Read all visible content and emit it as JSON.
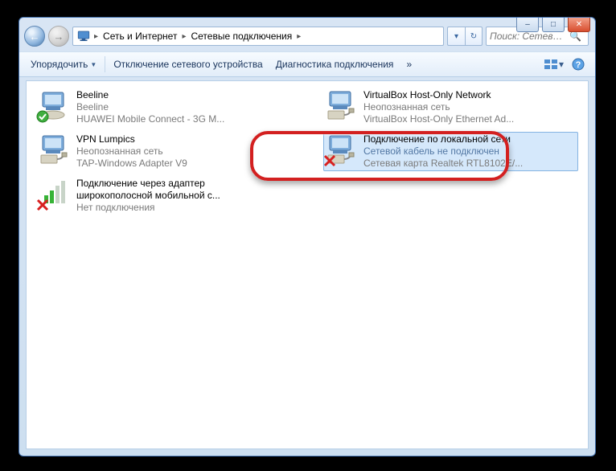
{
  "win_controls": {
    "min": "–",
    "max": "□",
    "close": "✕"
  },
  "breadcrumbs": {
    "a": "Сеть и Интернет",
    "b": "Сетевые подключения"
  },
  "search": {
    "placeholder": "Поиск: Сетев…",
    "icon": "🔍"
  },
  "refresh": {
    "down": "▾",
    "ref": "↻"
  },
  "toolbar": {
    "organize": "Упорядочить",
    "disable": "Отключение сетевого устройства",
    "diag": "Диагностика подключения",
    "more": "»",
    "view_drop": "▾",
    "help": "?"
  },
  "items": {
    "beeline": {
      "l1": "Beeline",
      "l2": "Beeline",
      "l3": "HUAWEI Mobile Connect - 3G M..."
    },
    "vbox": {
      "l1": "VirtualBox Host-Only Network",
      "l2": "Неопознанная сеть",
      "l3": "VirtualBox Host-Only Ethernet Ad..."
    },
    "vpn": {
      "l1": "VPN Lumpics",
      "l2": "Неопознанная сеть",
      "l3": "TAP-Windows Adapter V9"
    },
    "lan": {
      "l1": "Подключение по локальной сети",
      "l2": "Сетевой кабель не подключен",
      "l3": "Сетевая карта Realtek RTL8102E/..."
    },
    "broad": {
      "l1": "Подключение через адаптер",
      "l1b": "широкополосной мобильной с...",
      "l3": "Нет подключения"
    }
  }
}
